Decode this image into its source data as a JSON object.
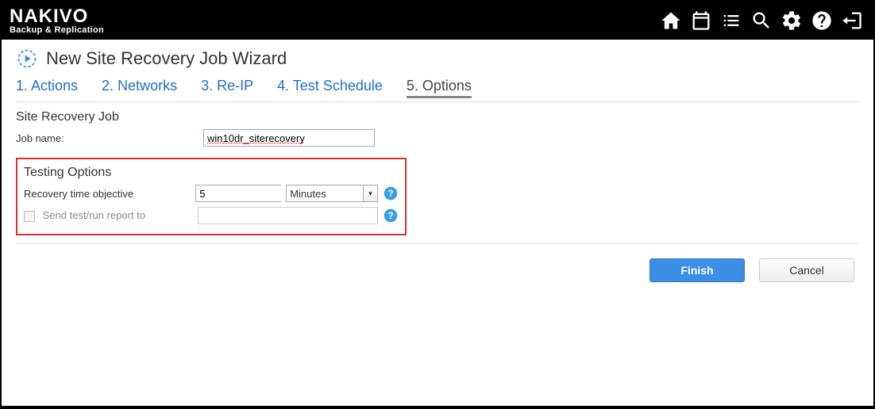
{
  "brand": {
    "title": "NAKIVO",
    "subtitle": "Backup & Replication"
  },
  "wizard_title": "New Site Recovery Job Wizard",
  "tabs": [
    {
      "label": "1. Actions"
    },
    {
      "label": "2. Networks"
    },
    {
      "label": "3. Re-IP"
    },
    {
      "label": "4. Test Schedule"
    },
    {
      "label": "5. Options"
    }
  ],
  "section1": {
    "title": "Site Recovery Job",
    "job_name_label": "Job name:",
    "job_name_value": "win10dr_siterecovery"
  },
  "section2": {
    "title": "Testing Options",
    "rto_label": "Recovery time objective",
    "rto_value": "5",
    "rto_unit": "Minutes",
    "report_label": "Send test/run report to",
    "report_value": ""
  },
  "buttons": {
    "finish": "Finish",
    "cancel": "Cancel"
  }
}
